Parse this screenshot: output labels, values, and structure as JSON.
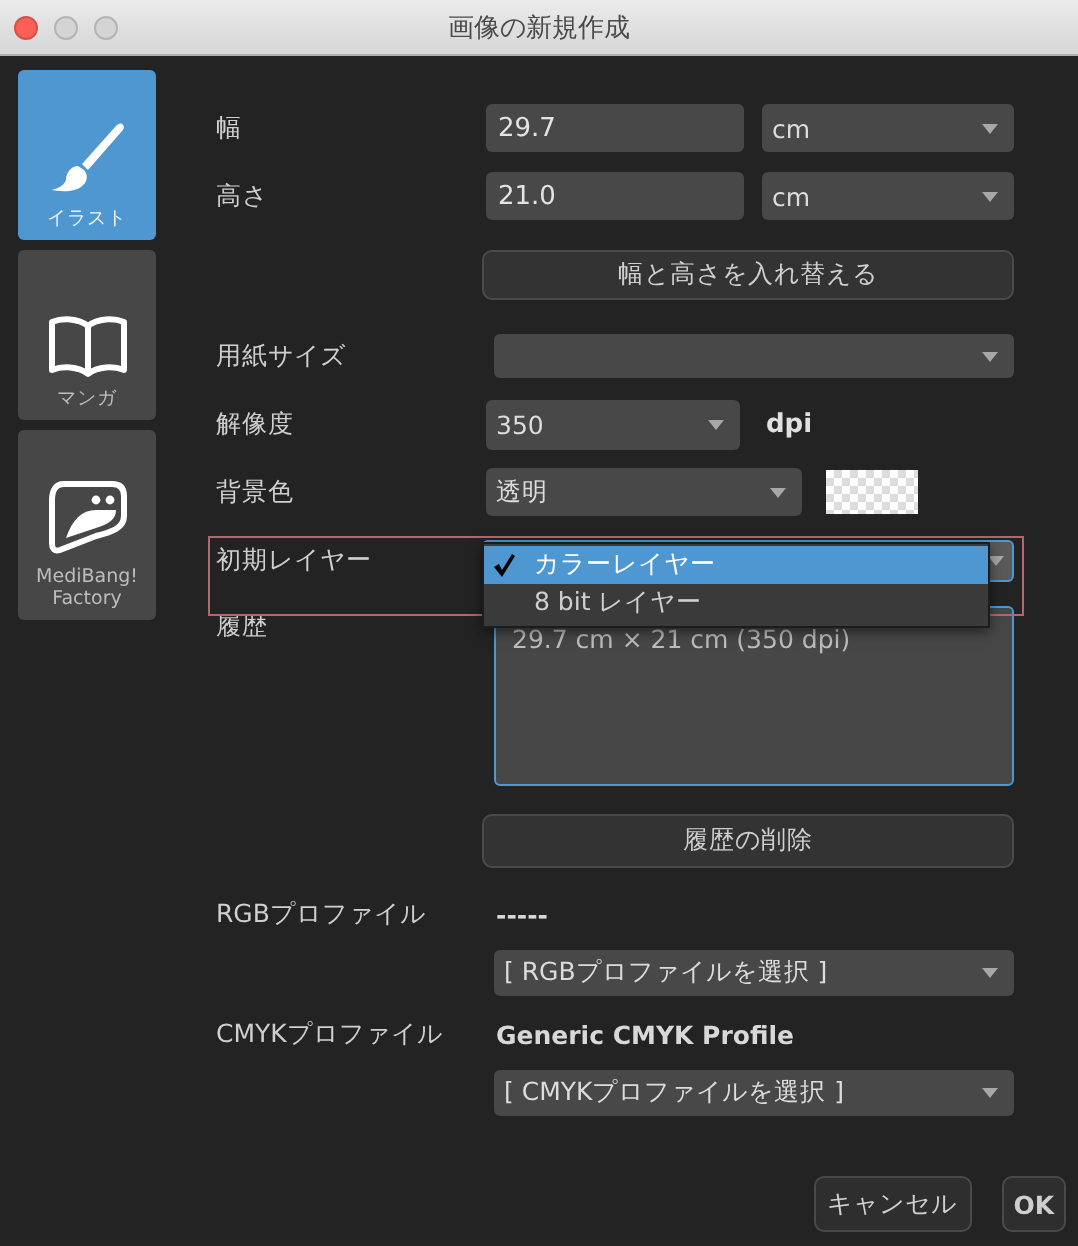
{
  "window": {
    "title": "画像の新規作成"
  },
  "sidebar": {
    "items": [
      {
        "label": "イラスト",
        "selected": true,
        "kind": "brush"
      },
      {
        "label": "マンガ",
        "selected": false,
        "kind": "book"
      },
      {
        "label": "MediBang! Factory",
        "selected": false,
        "kind": "factory"
      }
    ]
  },
  "width": {
    "label": "幅",
    "value": "29.7",
    "unit": "cm"
  },
  "height": {
    "label": "高さ",
    "value": "21.0",
    "unit": "cm"
  },
  "swap_button": "幅と高さを入れ替える",
  "paper_size": {
    "label": "用紙サイズ"
  },
  "resolution": {
    "label": "解像度",
    "value": "350",
    "unit": "dpi"
  },
  "background": {
    "label": "背景色",
    "value": "透明"
  },
  "initial_layer": {
    "label": "初期レイヤー",
    "highlighted": true,
    "options": [
      {
        "label": "カラーレイヤー",
        "selected": true
      },
      {
        "label": "8 bit レイヤー",
        "selected": false
      }
    ]
  },
  "history": {
    "label": "履歴",
    "entries": [
      "29.7 cm × 21 cm (350 dpi)"
    ]
  },
  "clear_history_button": "履歴の削除",
  "rgb_profile": {
    "label": "RGBプロファイル",
    "value": "-----",
    "select": "[ RGBプロファイルを選択 ]"
  },
  "cmyk_profile": {
    "label": "CMYKプロファイル",
    "value": "Generic CMYK Profile",
    "select": "[ CMYKプロファイルを選択 ]"
  },
  "buttons": [
    {
      "label": "キャンセル",
      "kind": "cancel"
    },
    {
      "label": "OK",
      "kind": "default"
    }
  ]
}
